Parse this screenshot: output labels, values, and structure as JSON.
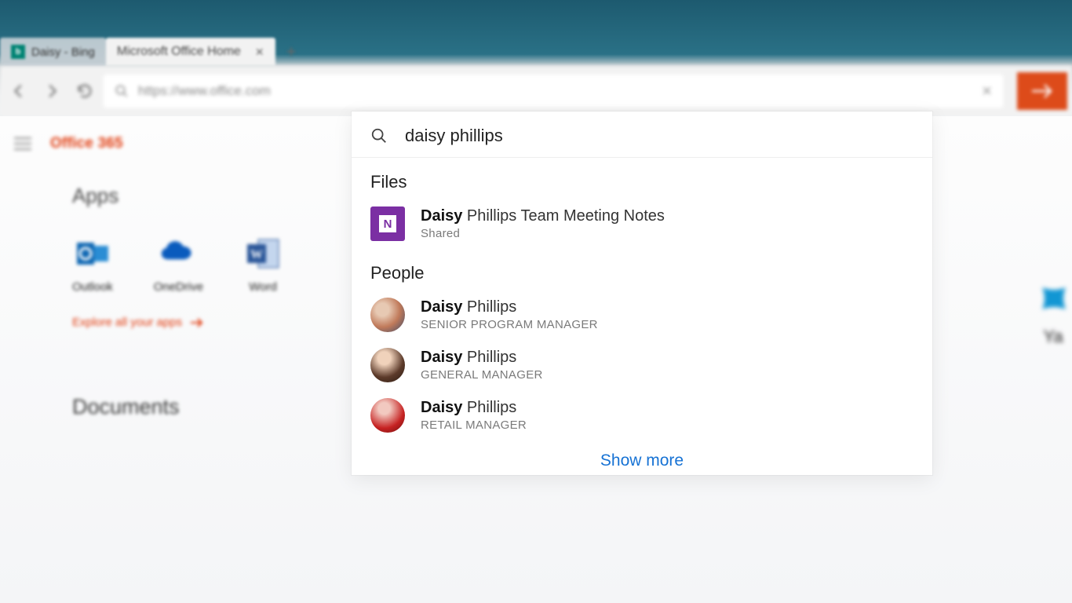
{
  "browser": {
    "tabs": [
      {
        "label": "Daisy - Bing",
        "active": false
      },
      {
        "label": "Microsoft Office Home",
        "active": true
      }
    ],
    "new_tab_glyph": "+",
    "address_url": "https://www.office.com"
  },
  "brand": "Office 365",
  "sections": {
    "apps_title": "Apps",
    "documents_title": "Documents",
    "explore_label": "Explore all your apps"
  },
  "apps": [
    {
      "name": "Outlook",
      "color": "#1068b3"
    },
    {
      "name": "OneDrive",
      "color": "#0a5bbd"
    },
    {
      "name": "Word",
      "color": "#2a5699"
    }
  ],
  "right_peek_label": "Ya",
  "search": {
    "query": "daisy phillips",
    "groups": {
      "files_title": "Files",
      "people_title": "People"
    },
    "files": [
      {
        "title_bold": "Daisy",
        "title_rest": " Phillips Team Meeting Notes",
        "sub": "Shared",
        "icon": "onenote"
      }
    ],
    "people": [
      {
        "title_bold": "Daisy",
        "title_rest": " Phillips",
        "sub": "SENIOR PROGRAM MANAGER"
      },
      {
        "title_bold": "Daisy",
        "title_rest": " Phillips",
        "sub": "GENERAL MANAGER"
      },
      {
        "title_bold": "Daisy",
        "title_rest": " Phillips",
        "sub": "RETAIL MANAGER"
      }
    ],
    "show_more": "Show more"
  }
}
